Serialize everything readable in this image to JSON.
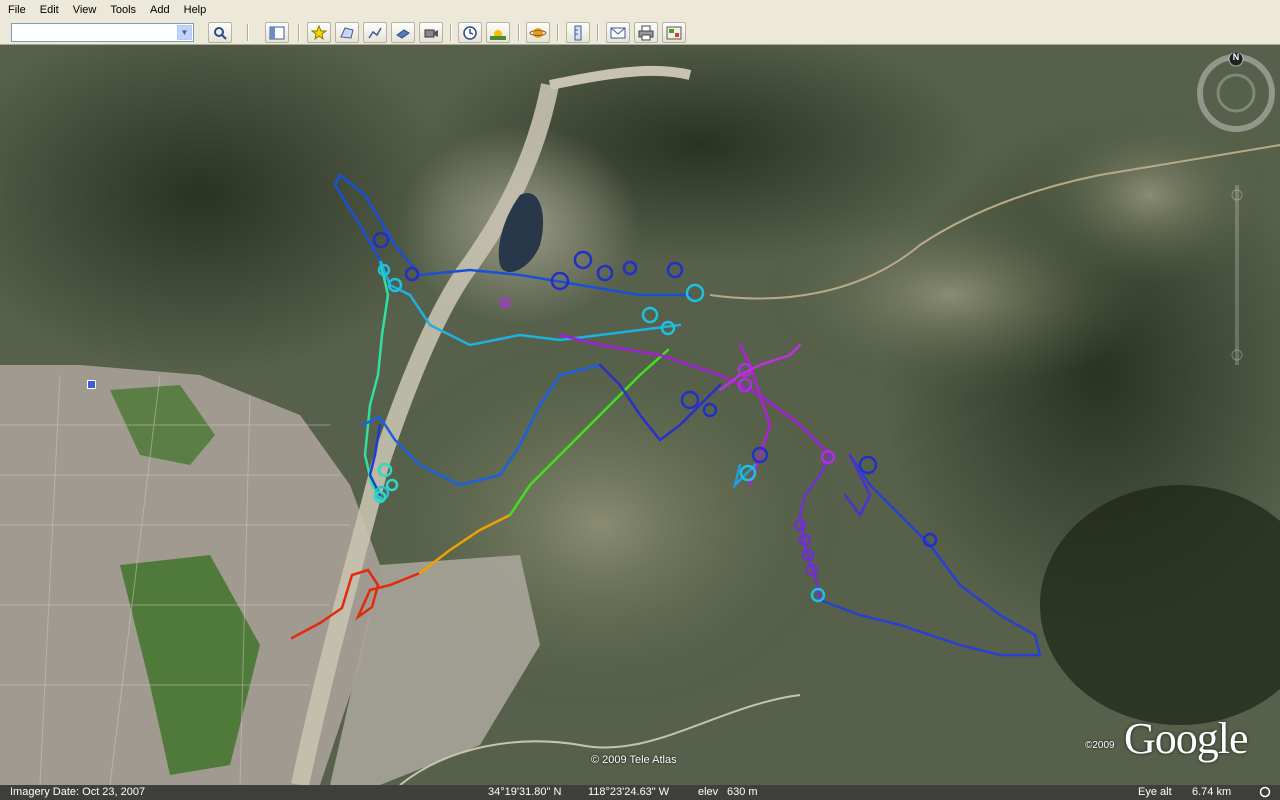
{
  "menu": [
    "File",
    "Edit",
    "View",
    "Tools",
    "Add",
    "Help"
  ],
  "search": {
    "value": "",
    "placeholder": ""
  },
  "toolbar": {
    "buttons": [
      "search-icon",
      "sidebar-toggle-icon",
      "placemark-icon",
      "polygon-icon",
      "path-icon",
      "image-overlay-icon",
      "record-tour-icon",
      "historical-imagery-icon",
      "sunlight-icon",
      "planets-icon",
      "ruler-icon",
      "email-icon",
      "print-icon",
      "view-in-maps-icon"
    ]
  },
  "map": {
    "attribution": "© 2009 Tele Atlas",
    "google_copyright": "©2009",
    "google_logo": "Google",
    "compass_label": "N"
  },
  "status": {
    "imagery_date": "Imagery Date: Oct 23, 2007",
    "latitude": "34°19'31.80\" N",
    "longitude": "118°23'24.63\" W",
    "elevation_label": "elev",
    "elevation": "630 m",
    "eye_alt_label": "Eye alt",
    "eye_alt": "6.74 km"
  },
  "colors": {
    "track_start": "#e02020",
    "track_mid": "#20d0e0",
    "track_end": "#c020e0"
  }
}
